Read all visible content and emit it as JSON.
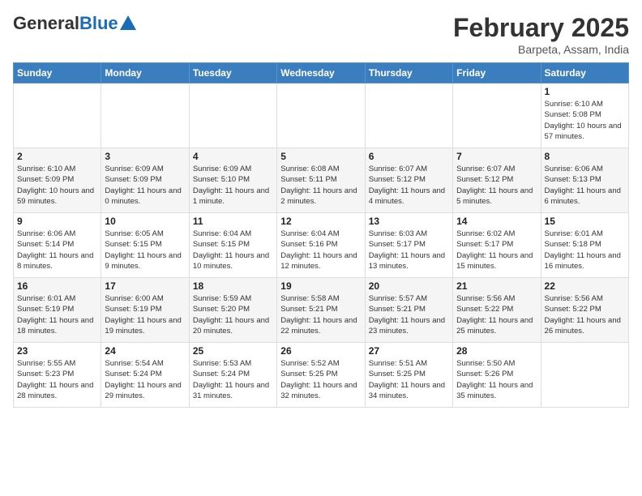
{
  "header": {
    "logo_general": "General",
    "logo_blue": "Blue",
    "month_title": "February 2025",
    "location": "Barpeta, Assam, India"
  },
  "weekdays": [
    "Sunday",
    "Monday",
    "Tuesday",
    "Wednesday",
    "Thursday",
    "Friday",
    "Saturday"
  ],
  "weeks": [
    [
      {
        "day": "",
        "info": ""
      },
      {
        "day": "",
        "info": ""
      },
      {
        "day": "",
        "info": ""
      },
      {
        "day": "",
        "info": ""
      },
      {
        "day": "",
        "info": ""
      },
      {
        "day": "",
        "info": ""
      },
      {
        "day": "1",
        "info": "Sunrise: 6:10 AM\nSunset: 5:08 PM\nDaylight: 10 hours and 57 minutes."
      }
    ],
    [
      {
        "day": "2",
        "info": "Sunrise: 6:10 AM\nSunset: 5:09 PM\nDaylight: 10 hours and 59 minutes."
      },
      {
        "day": "3",
        "info": "Sunrise: 6:09 AM\nSunset: 5:09 PM\nDaylight: 11 hours and 0 minutes."
      },
      {
        "day": "4",
        "info": "Sunrise: 6:09 AM\nSunset: 5:10 PM\nDaylight: 11 hours and 1 minute."
      },
      {
        "day": "5",
        "info": "Sunrise: 6:08 AM\nSunset: 5:11 PM\nDaylight: 11 hours and 2 minutes."
      },
      {
        "day": "6",
        "info": "Sunrise: 6:07 AM\nSunset: 5:12 PM\nDaylight: 11 hours and 4 minutes."
      },
      {
        "day": "7",
        "info": "Sunrise: 6:07 AM\nSunset: 5:12 PM\nDaylight: 11 hours and 5 minutes."
      },
      {
        "day": "8",
        "info": "Sunrise: 6:06 AM\nSunset: 5:13 PM\nDaylight: 11 hours and 6 minutes."
      }
    ],
    [
      {
        "day": "9",
        "info": "Sunrise: 6:06 AM\nSunset: 5:14 PM\nDaylight: 11 hours and 8 minutes."
      },
      {
        "day": "10",
        "info": "Sunrise: 6:05 AM\nSunset: 5:15 PM\nDaylight: 11 hours and 9 minutes."
      },
      {
        "day": "11",
        "info": "Sunrise: 6:04 AM\nSunset: 5:15 PM\nDaylight: 11 hours and 10 minutes."
      },
      {
        "day": "12",
        "info": "Sunrise: 6:04 AM\nSunset: 5:16 PM\nDaylight: 11 hours and 12 minutes."
      },
      {
        "day": "13",
        "info": "Sunrise: 6:03 AM\nSunset: 5:17 PM\nDaylight: 11 hours and 13 minutes."
      },
      {
        "day": "14",
        "info": "Sunrise: 6:02 AM\nSunset: 5:17 PM\nDaylight: 11 hours and 15 minutes."
      },
      {
        "day": "15",
        "info": "Sunrise: 6:01 AM\nSunset: 5:18 PM\nDaylight: 11 hours and 16 minutes."
      }
    ],
    [
      {
        "day": "16",
        "info": "Sunrise: 6:01 AM\nSunset: 5:19 PM\nDaylight: 11 hours and 18 minutes."
      },
      {
        "day": "17",
        "info": "Sunrise: 6:00 AM\nSunset: 5:19 PM\nDaylight: 11 hours and 19 minutes."
      },
      {
        "day": "18",
        "info": "Sunrise: 5:59 AM\nSunset: 5:20 PM\nDaylight: 11 hours and 20 minutes."
      },
      {
        "day": "19",
        "info": "Sunrise: 5:58 AM\nSunset: 5:21 PM\nDaylight: 11 hours and 22 minutes."
      },
      {
        "day": "20",
        "info": "Sunrise: 5:57 AM\nSunset: 5:21 PM\nDaylight: 11 hours and 23 minutes."
      },
      {
        "day": "21",
        "info": "Sunrise: 5:56 AM\nSunset: 5:22 PM\nDaylight: 11 hours and 25 minutes."
      },
      {
        "day": "22",
        "info": "Sunrise: 5:56 AM\nSunset: 5:22 PM\nDaylight: 11 hours and 26 minutes."
      }
    ],
    [
      {
        "day": "23",
        "info": "Sunrise: 5:55 AM\nSunset: 5:23 PM\nDaylight: 11 hours and 28 minutes."
      },
      {
        "day": "24",
        "info": "Sunrise: 5:54 AM\nSunset: 5:24 PM\nDaylight: 11 hours and 29 minutes."
      },
      {
        "day": "25",
        "info": "Sunrise: 5:53 AM\nSunset: 5:24 PM\nDaylight: 11 hours and 31 minutes."
      },
      {
        "day": "26",
        "info": "Sunrise: 5:52 AM\nSunset: 5:25 PM\nDaylight: 11 hours and 32 minutes."
      },
      {
        "day": "27",
        "info": "Sunrise: 5:51 AM\nSunset: 5:25 PM\nDaylight: 11 hours and 34 minutes."
      },
      {
        "day": "28",
        "info": "Sunrise: 5:50 AM\nSunset: 5:26 PM\nDaylight: 11 hours and 35 minutes."
      },
      {
        "day": "",
        "info": ""
      }
    ]
  ]
}
